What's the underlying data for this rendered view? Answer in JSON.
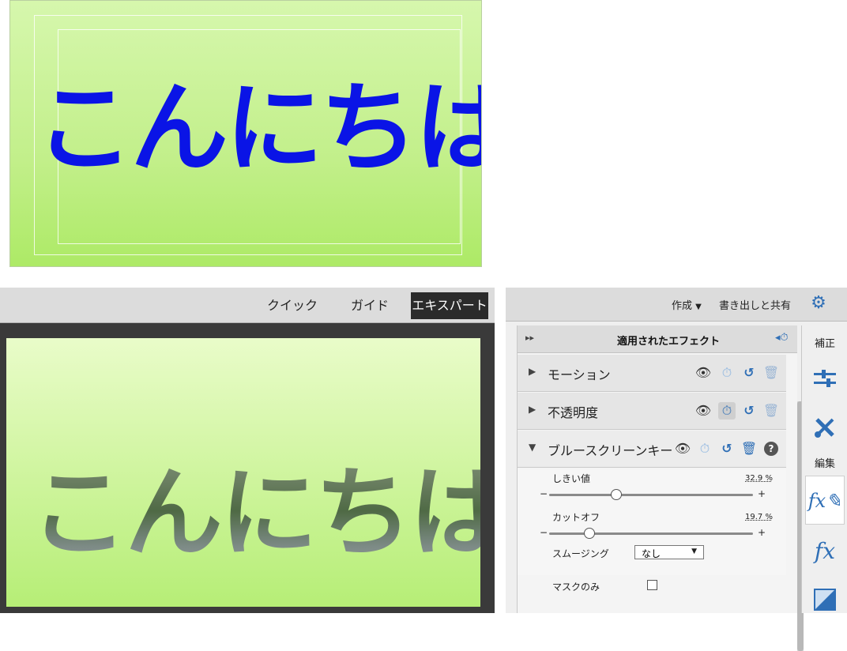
{
  "top_preview": {
    "title": "こんにちは"
  },
  "mode_tabs": [
    {
      "label": "クイック",
      "active": false
    },
    {
      "label": "ガイド",
      "active": false
    },
    {
      "label": "エキスパート",
      "active": true
    }
  ],
  "canvas": {
    "title": "こんにちは"
  },
  "panel_header": {
    "create_label": "作成",
    "create_caret": "▼",
    "share_label": "書き出しと共有",
    "gear_icon": "gear-icon"
  },
  "applied_effects": {
    "collapse_glyph": "▸▸",
    "title": "適用されたエフェクト",
    "rows": [
      {
        "label": "モーション",
        "expanded": false
      },
      {
        "label": "不透明度",
        "expanded": false
      },
      {
        "label": "ブルースクリーンキー",
        "expanded": true
      }
    ],
    "blue_screen_key": {
      "threshold": {
        "label": "しきい値",
        "value": "32.9 %",
        "fraction": 0.329
      },
      "cutoff": {
        "label": "カットオフ",
        "value": "19.7 %",
        "fraction": 0.197
      },
      "smoothing": {
        "label": "スムージング",
        "value": "なし"
      },
      "mask_only": {
        "label": "マスクのみ",
        "checked": false
      },
      "minus": "−",
      "plus": "+"
    }
  },
  "side_panel": {
    "adjust_label": "補正",
    "edit_label": "編集"
  },
  "colors": {
    "title_blue": "#0a14e6",
    "accent": "#2f6fb6",
    "green_bg": "#c2ef8a"
  }
}
